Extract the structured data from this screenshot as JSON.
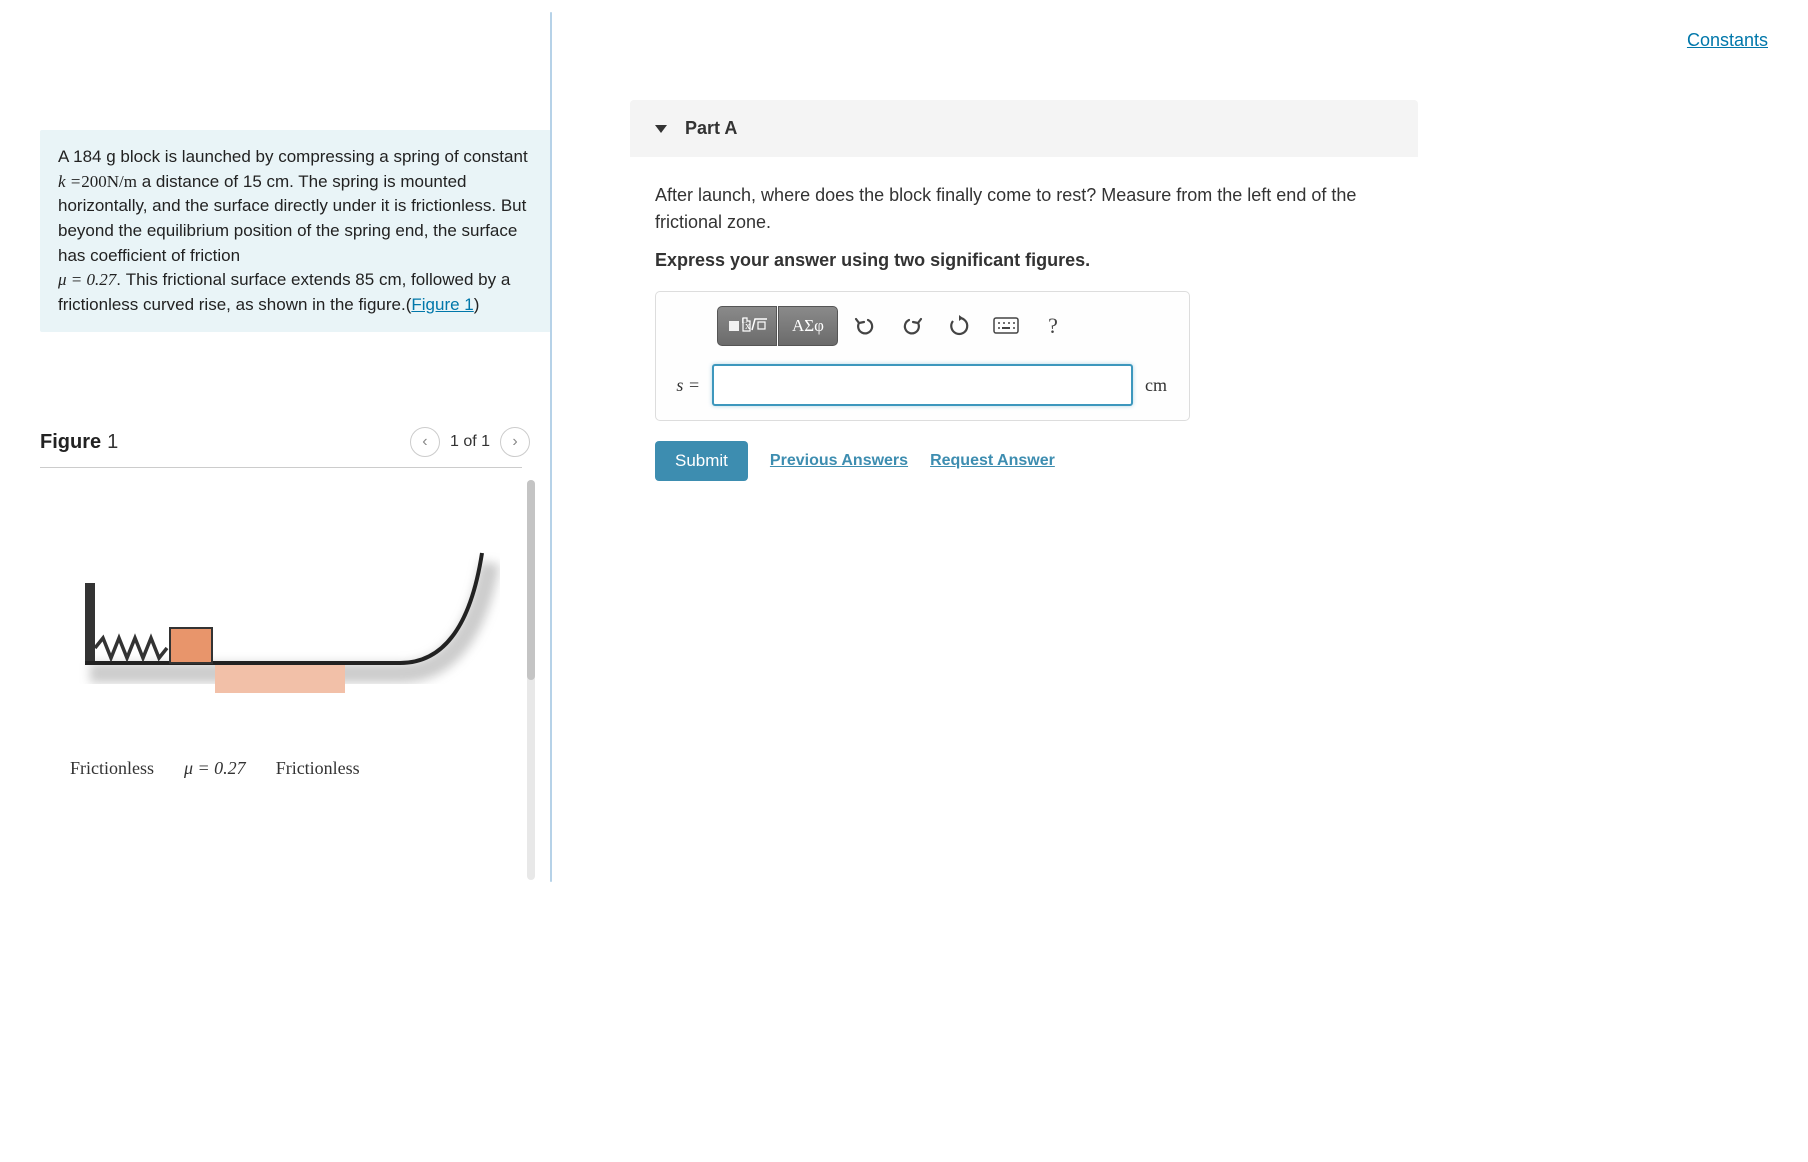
{
  "top": {
    "constants_link": "Constants"
  },
  "problem": {
    "text_before": "A 184 g block is launched by compressing a spring of constant ",
    "k_expr": "k =",
    "k_val": "200N/m",
    "text_mid1": " a distance of 15 cm. The spring is mounted horizontally, and the surface directly under it is frictionless. But beyond the equilibrium position of the spring end, the surface has coefficient of friction ",
    "mu_expr": "μ = 0.27",
    "text_mid2": ". This frictional surface extends 85 cm, followed by a frictionless curved rise, as shown in the figure.(",
    "figure_link": "Figure 1",
    "text_after": ")"
  },
  "figure": {
    "label": "Figure",
    "number": "1",
    "nav_count": "1 of 1",
    "caption_left": "Frictionless",
    "caption_mid": "μ = 0.27",
    "caption_right": "Frictionless"
  },
  "part": {
    "title": "Part A",
    "question": "After launch, where does the block finally come to rest? Measure from the left end of the frictional zone.",
    "instruction": "Express your answer using two significant figures.",
    "toolbar_greek": "ΑΣφ",
    "answer_label": "s =",
    "answer_value": "",
    "answer_unit": "cm",
    "submit": "Submit",
    "prev_answers": "Previous Answers",
    "request_answer": "Request Answer"
  }
}
